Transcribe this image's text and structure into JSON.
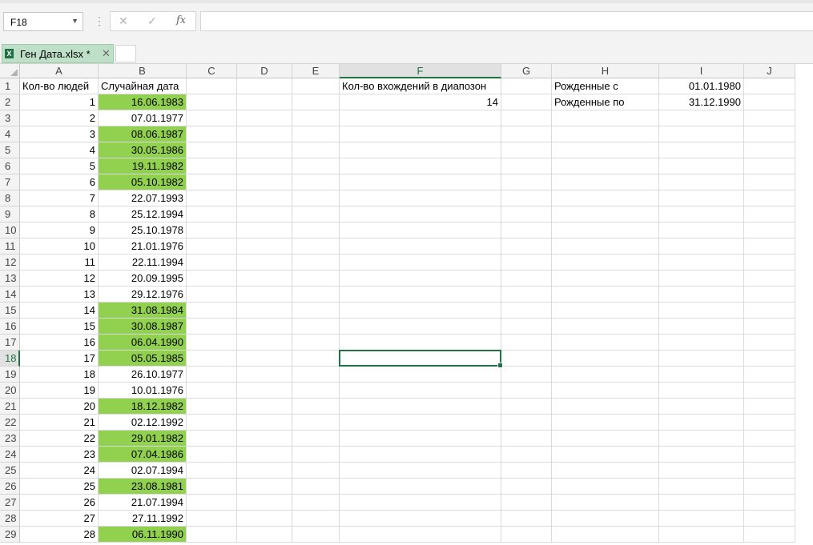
{
  "formula_bar": {
    "name_box": "F18",
    "separator": "⋮",
    "cancel_icon": "✕",
    "enter_icon": "✓",
    "fx_label": "fx",
    "formula": ""
  },
  "workbook_tab": {
    "icon_letter": "X",
    "name": "Ген Дата.xlsx *",
    "close_icon": "✕"
  },
  "colors": {
    "highlight": "#92d050",
    "selection": "#217346"
  },
  "active_cell": "F18",
  "columns": [
    "A",
    "B",
    "C",
    "D",
    "E",
    "F",
    "G",
    "H",
    "I",
    "J"
  ],
  "rows": [
    {
      "n": "1",
      "A": "Кол-во людей",
      "B": "Случайная дата",
      "F": "Кол-во вхождений в диапозон",
      "H": "Рожденные с",
      "I": "01.01.1980"
    },
    {
      "n": "2",
      "A": "1",
      "B": "16.06.1983",
      "hl": true,
      "F": "14",
      "H": "Рожденные по",
      "I": "31.12.1990"
    },
    {
      "n": "3",
      "A": "2",
      "B": "07.01.1977",
      "hl": false
    },
    {
      "n": "4",
      "A": "3",
      "B": "08.06.1987",
      "hl": true
    },
    {
      "n": "5",
      "A": "4",
      "B": "30.05.1986",
      "hl": true
    },
    {
      "n": "6",
      "A": "5",
      "B": "19.11.1982",
      "hl": true
    },
    {
      "n": "7",
      "A": "6",
      "B": "05.10.1982",
      "hl": true
    },
    {
      "n": "8",
      "A": "7",
      "B": "22.07.1993",
      "hl": false
    },
    {
      "n": "9",
      "A": "8",
      "B": "25.12.1994",
      "hl": false
    },
    {
      "n": "10",
      "A": "9",
      "B": "25.10.1978",
      "hl": false
    },
    {
      "n": "11",
      "A": "10",
      "B": "21.01.1976",
      "hl": false
    },
    {
      "n": "12",
      "A": "11",
      "B": "22.11.1994",
      "hl": false
    },
    {
      "n": "13",
      "A": "12",
      "B": "20.09.1995",
      "hl": false
    },
    {
      "n": "14",
      "A": "13",
      "B": "29.12.1976",
      "hl": false
    },
    {
      "n": "15",
      "A": "14",
      "B": "31.08.1984",
      "hl": true
    },
    {
      "n": "16",
      "A": "15",
      "B": "30.08.1987",
      "hl": true
    },
    {
      "n": "17",
      "A": "16",
      "B": "06.04.1990",
      "hl": true
    },
    {
      "n": "18",
      "A": "17",
      "B": "05.05.1985",
      "hl": true
    },
    {
      "n": "19",
      "A": "18",
      "B": "26.10.1977",
      "hl": false
    },
    {
      "n": "20",
      "A": "19",
      "B": "10.01.1976",
      "hl": false
    },
    {
      "n": "21",
      "A": "20",
      "B": "18.12.1982",
      "hl": true
    },
    {
      "n": "22",
      "A": "21",
      "B": "02.12.1992",
      "hl": false
    },
    {
      "n": "23",
      "A": "22",
      "B": "29.01.1982",
      "hl": true
    },
    {
      "n": "24",
      "A": "23",
      "B": "07.04.1986",
      "hl": true
    },
    {
      "n": "25",
      "A": "24",
      "B": "02.07.1994",
      "hl": false
    },
    {
      "n": "26",
      "A": "25",
      "B": "23.08.1981",
      "hl": true
    },
    {
      "n": "27",
      "A": "26",
      "B": "21.07.1994",
      "hl": false
    },
    {
      "n": "28",
      "A": "27",
      "B": "27.11.1992",
      "hl": false
    },
    {
      "n": "29",
      "A": "28",
      "B": "06.11.1990",
      "hl": true
    }
  ]
}
